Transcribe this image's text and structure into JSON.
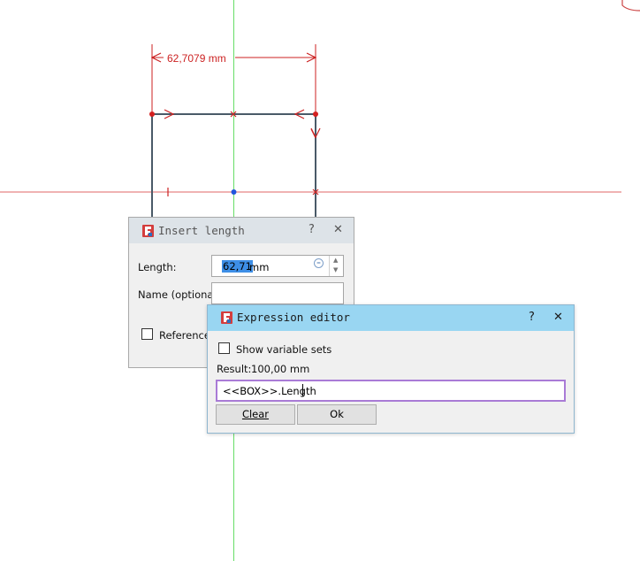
{
  "drawing": {
    "dimension_label": "62,7079 mm",
    "colors": {
      "dimension": "#cc2222",
      "geometry": "#4a5a68",
      "axis_h": "#e06666",
      "axis_v": "#66dd66",
      "point": "#d42020",
      "midpoint": "#2255dd"
    }
  },
  "insert_dialog": {
    "title": "Insert length",
    "help_label": "?",
    "close_label": "✕",
    "length_label": "Length:",
    "length_value": "62,71",
    "length_unit": "mm",
    "name_label": "Name (optional)",
    "name_value": "",
    "reference_label": "Reference",
    "reference_checked": false
  },
  "expression_dialog": {
    "title": "Expression editor",
    "help_label": "?",
    "close_label": "✕",
    "show_variable_sets_label": "Show variable sets",
    "show_variable_sets_checked": false,
    "result_label": "Result:",
    "result_value": "100,00 mm",
    "expression_value": "<<BOX>>.Length",
    "clear_label": "Clear",
    "ok_label": "Ok"
  }
}
